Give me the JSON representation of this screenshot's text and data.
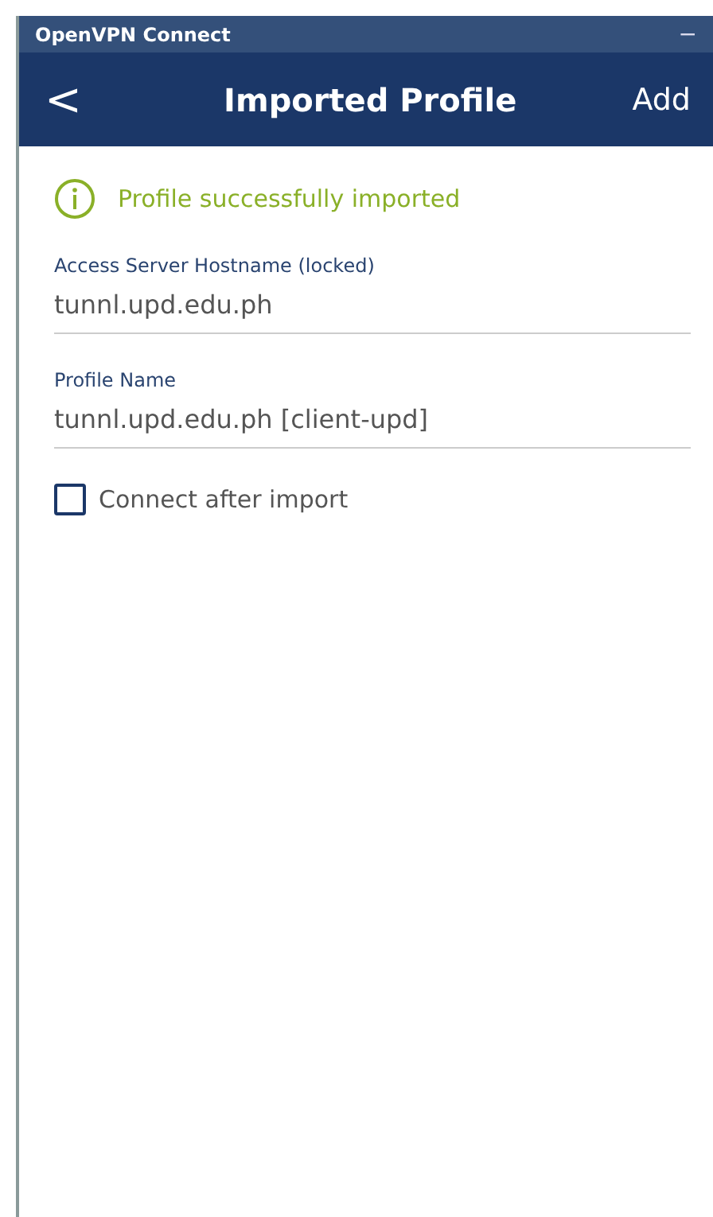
{
  "window": {
    "title": "OpenVPN Connect",
    "controls": [
      "−"
    ]
  },
  "header": {
    "back": "<",
    "title": "Imported Profile",
    "action": "Add"
  },
  "notice": {
    "text": "Profile successfully imported"
  },
  "fields": [
    {
      "label": "Access Server Hostname (locked)",
      "value": "tunnl.upd.edu.ph"
    },
    {
      "label": "Profile Name",
      "value": "tunnl.upd.edu.ph [client-upd]"
    }
  ],
  "checkbox": {
    "label": "Connect after import",
    "checked": false
  }
}
